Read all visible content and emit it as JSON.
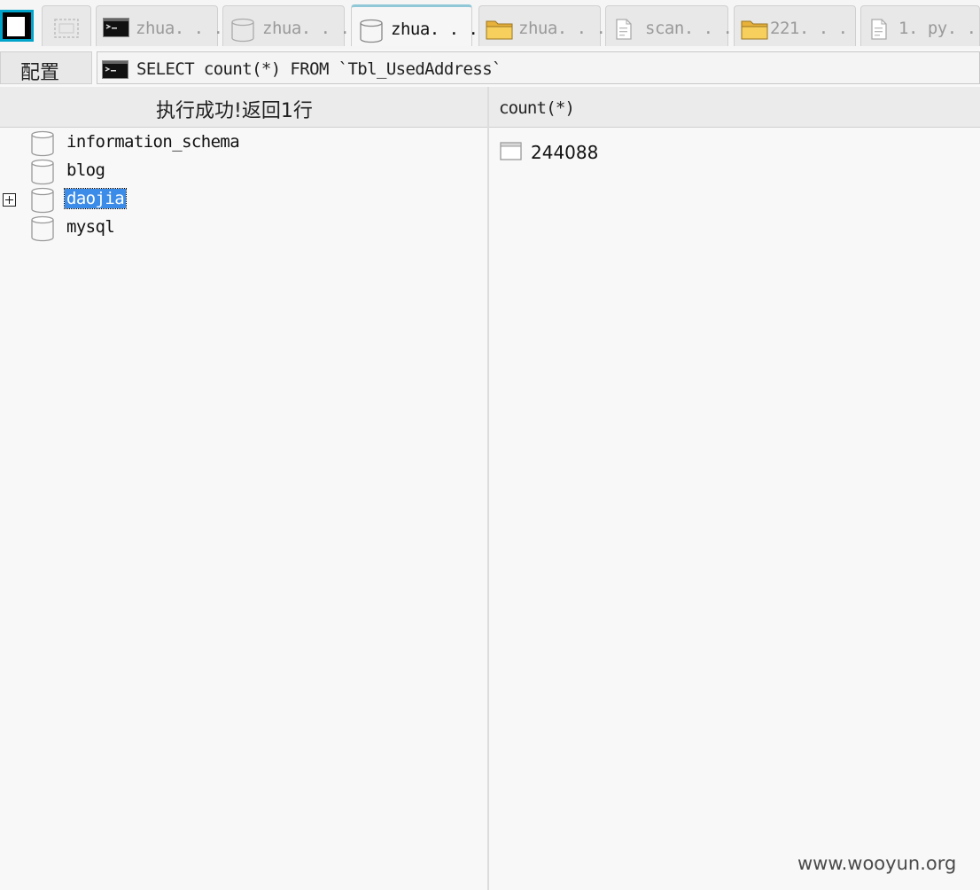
{
  "tabs": [
    {
      "label": "",
      "icon": "selection-icon"
    },
    {
      "label": "zhua. . .",
      "icon": "terminal-icon"
    },
    {
      "label": "zhua. . .",
      "icon": "database-icon"
    },
    {
      "label": "zhua. . .",
      "icon": "database-icon",
      "active": true
    },
    {
      "label": "zhua. . .",
      "icon": "folder-icon"
    },
    {
      "label": "scan. . .",
      "icon": "file-icon"
    },
    {
      "label": "221. . . .",
      "icon": "folder-icon"
    },
    {
      "label": "1. py. . .",
      "icon": "file-icon"
    }
  ],
  "command_bar": {
    "config_label": "配置",
    "query": "SELECT count(*) FROM `Tbl_UsedAddress`"
  },
  "left_pane": {
    "status": "执行成功!返回1行",
    "databases": [
      "information_schema",
      "blog",
      "daojia",
      "mysql"
    ],
    "selected": "daojia"
  },
  "right_pane": {
    "column_header": "count(*)",
    "rows": [
      "244088"
    ]
  },
  "watermark": "www.wooyun.org",
  "colors": {
    "accent": "#00a3c9",
    "selection": "#3b8be8",
    "folder": "#e8b23a"
  }
}
